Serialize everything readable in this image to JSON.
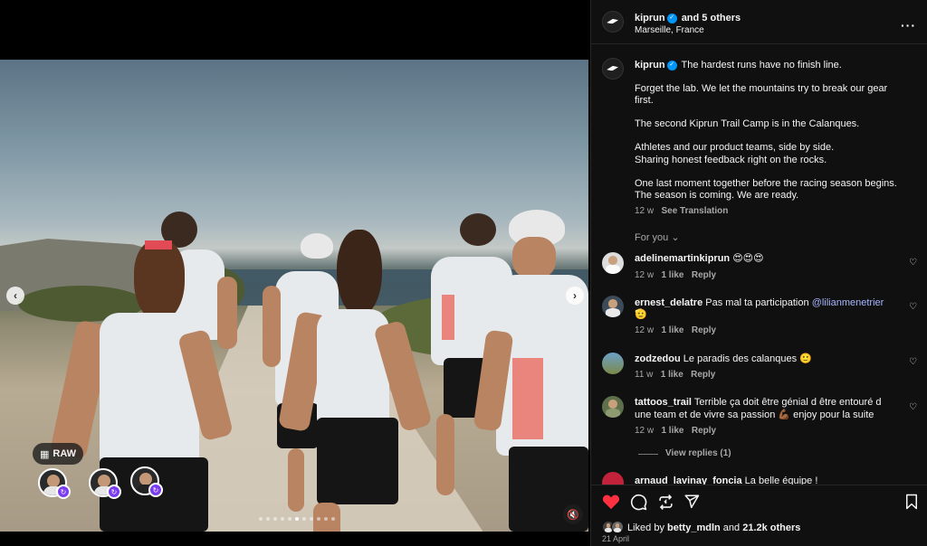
{
  "post": {
    "author": "kiprun",
    "and_others": "and 5 others",
    "location": "Marseille, France"
  },
  "media": {
    "raw_label": "RAW",
    "slide_count": 11,
    "active_slide": 5
  },
  "caption": {
    "author": "kiprun",
    "lines": [
      "The hardest runs have no finish line.",
      "Forget the lab. We let the mountains try to break our gear",
      "first.",
      "The second Kiprun Trail Camp is in the Calanques.",
      "Athletes and our product teams, side by side.",
      "Sharing honest feedback right on the rocks.",
      "One last moment together before the racing season begins.",
      "The season is coming. We are ready."
    ],
    "time": "12 w",
    "see_translation": "See Translation"
  },
  "for_you": "For you",
  "comments": [
    {
      "user": "adelinemartinkiprun",
      "text": "😍😍😍",
      "time": "12 w",
      "likes": "1 like",
      "reply": "Reply"
    },
    {
      "user": "ernest_delatre",
      "text": "Pas mal ta participation",
      "mention": "@lilianmenetrier",
      "text2": "🫡",
      "time": "12 w",
      "likes": "1 like",
      "reply": "Reply"
    },
    {
      "user": "zodzedou",
      "text": "Le paradis des calanques 🙂",
      "time": "11 w",
      "likes": "1 like",
      "reply": "Reply"
    },
    {
      "user": "tattoos_trail",
      "text": "Terrible ça doit être génial d être entouré d",
      "text2": "une team et de vivre sa passion 💪🏾 enjoy pour la suite",
      "time": "12 w",
      "likes": "1 like",
      "reply": "Reply"
    },
    {
      "user": "arnaud_lavinay_foncia",
      "text": "La belle équipe !"
    }
  ],
  "view_replies": "View replies (1)",
  "likes": {
    "prefix": "Liked by",
    "user": "betty_mdln",
    "suffix": "and",
    "count": "21.2k others"
  },
  "date": "21 April",
  "colors": {
    "like_red": "#ff3040",
    "verified_blue": "#0095f6",
    "mention": "#a8b6ff"
  }
}
